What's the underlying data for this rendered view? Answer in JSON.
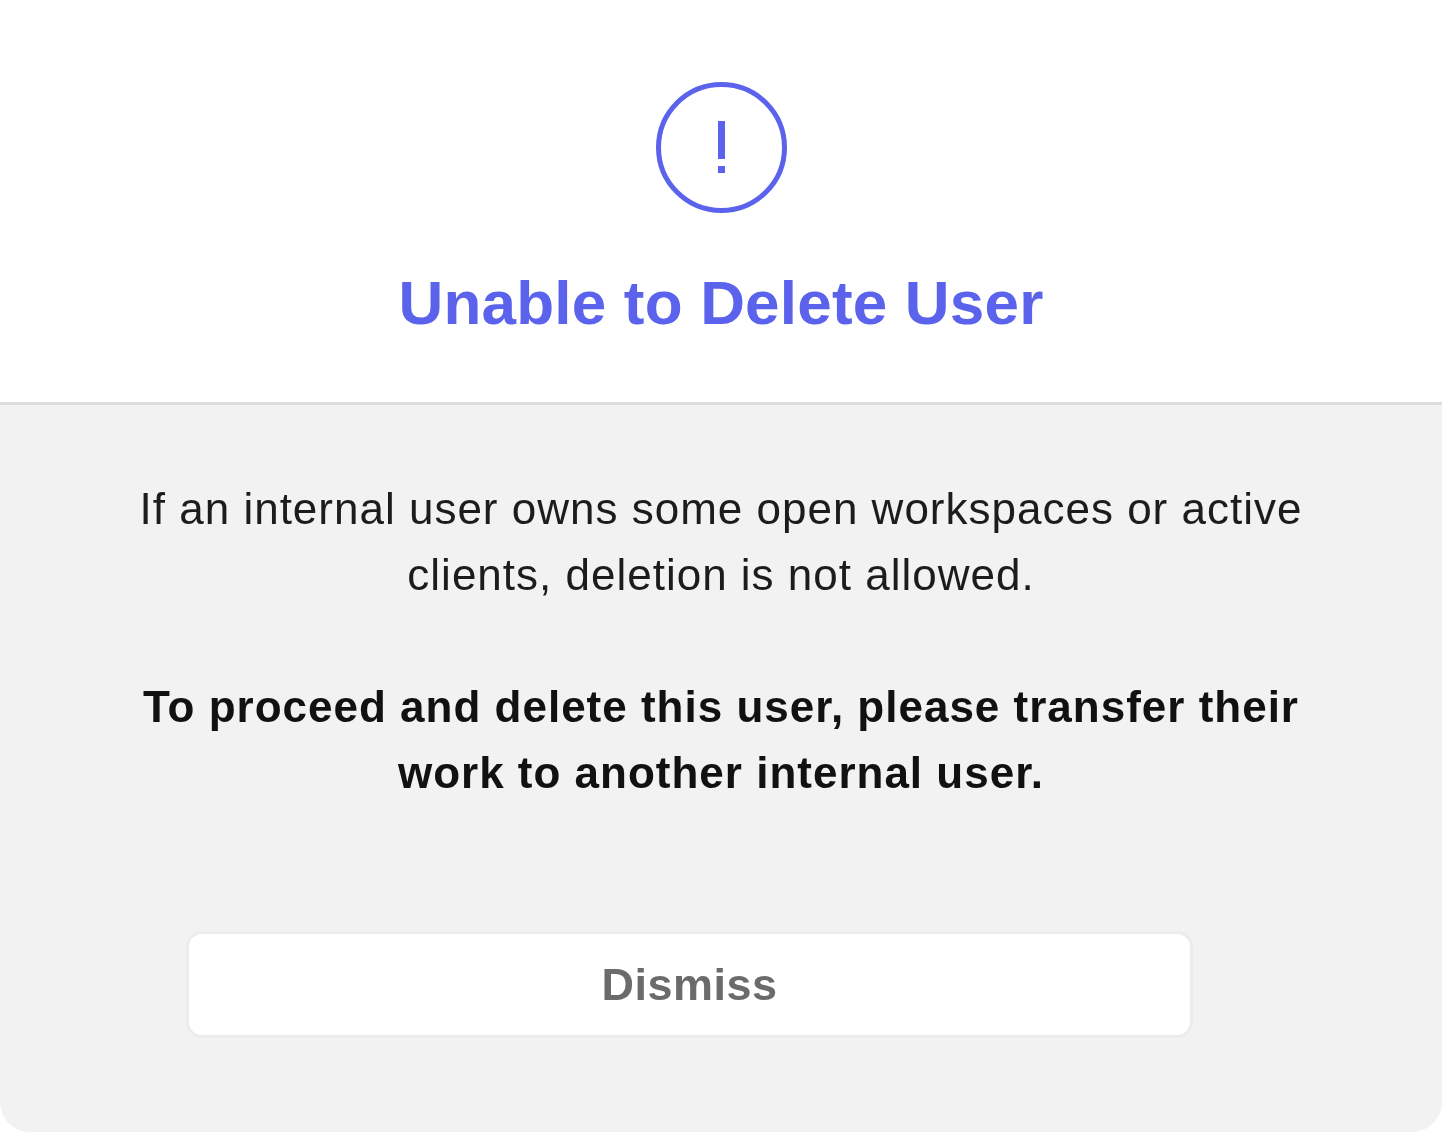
{
  "dialog": {
    "title": "Unable to Delete User",
    "paragraphs": [
      {
        "kind": "plain",
        "text": "If an internal user owns some open workspaces or active clients, deletion is not allowed."
      },
      {
        "kind": "emphasis",
        "text": "To proceed and delete this user, please transfer their work to another internal user."
      }
    ],
    "buttons": [
      {
        "label": "Dismiss"
      }
    ]
  }
}
